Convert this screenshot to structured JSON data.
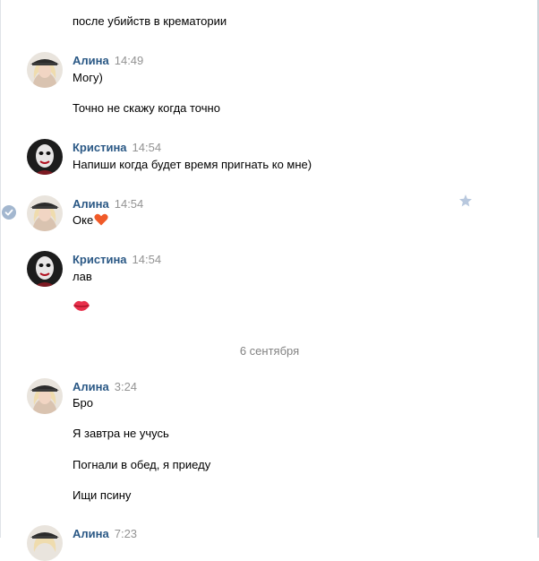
{
  "messages": {
    "m0": {
      "text": "после убийств в крематории"
    },
    "m1": {
      "author": "Алина",
      "time": "14:49",
      "lines": [
        "Могу)",
        "Точно не скажу когда точно"
      ]
    },
    "m2": {
      "author": "Кристина",
      "time": "14:54",
      "lines": [
        "Напиши когда будет время пригнать ко мне)"
      ]
    },
    "m3": {
      "author": "Алина",
      "time": "14:54",
      "text": "Оке"
    },
    "m4": {
      "author": "Кристина",
      "time": "14:54",
      "lines": [
        "лав"
      ]
    },
    "date_separator": "6 сентября",
    "m5": {
      "author": "Алина",
      "time": "3:24",
      "lines": [
        "Бро",
        "Я завтра не учусь",
        "Погнали в обед, я приеду",
        "Ищи псину"
      ]
    },
    "m6": {
      "author": "Алина",
      "time": "7:23"
    }
  },
  "icons": {
    "heart": "heart-emoji",
    "lips": "kiss-emoji",
    "star": "star-icon",
    "check": "check-icon"
  },
  "colors": {
    "author": "#2a5885",
    "time": "#939393",
    "star": "#b8c8de",
    "check": "#a3b7cf",
    "heart": "#f05a28",
    "lips": "#e8304b"
  }
}
